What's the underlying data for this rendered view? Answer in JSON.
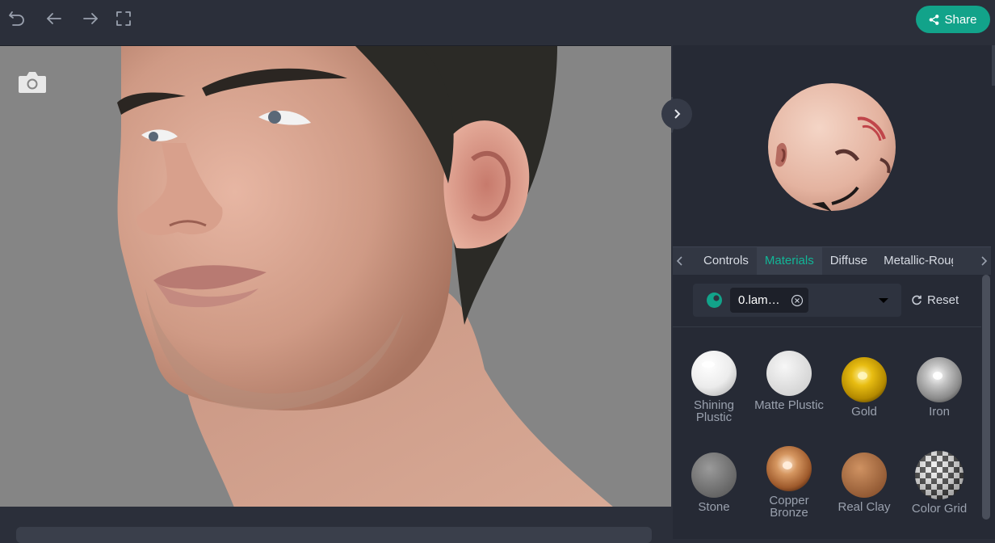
{
  "topbar": {
    "icons": [
      "undo-icon",
      "back-arrow-icon",
      "forward-arrow-icon",
      "fullscreen-icon"
    ],
    "share_label": "Share"
  },
  "viewport": {
    "camera_icon": "camera-icon",
    "background": "#858585"
  },
  "panel": {
    "tabs": [
      {
        "label": "Controls",
        "active": false
      },
      {
        "label": "Materials",
        "active": true
      },
      {
        "label": "Diffuse",
        "active": false
      },
      {
        "label": "Metallic-Roughness",
        "active": false
      }
    ],
    "selector": {
      "chip_label": "0.lam…",
      "reset_label": "Reset"
    },
    "materials": [
      {
        "label": "Shining Plustic",
        "color": "#f5f5f5"
      },
      {
        "label": "Matte Plustic",
        "color": "#ececec"
      },
      {
        "label": "Gold",
        "color": "#d9a800"
      },
      {
        "label": "Iron",
        "color": "#a8a8a8"
      },
      {
        "label": "Stone",
        "color": "#7d7d7d"
      },
      {
        "label": "Copper Bronze",
        "color": "#b8703c"
      },
      {
        "label": "Real Clay",
        "color": "#b57645"
      },
      {
        "label": "Color Grid",
        "color": "#444444"
      }
    ]
  },
  "colors": {
    "accent": "#12a38a",
    "active_tab_text": "#12b597",
    "panel_bg": "#262a35",
    "topbar_bg": "#2b2f3a"
  }
}
